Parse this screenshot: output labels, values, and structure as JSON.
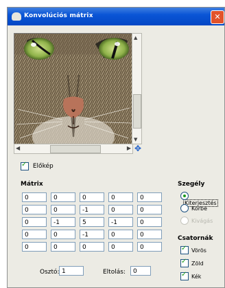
{
  "window": {
    "title": "Konvolúciós mátrix",
    "close_glyph": "✕"
  },
  "preview": {
    "label": "Előkép",
    "checked": true
  },
  "matrix": {
    "title": "Mátrix",
    "rows": [
      [
        "0",
        "0",
        "0",
        "0",
        "0"
      ],
      [
        "0",
        "0",
        "-1",
        "0",
        "0"
      ],
      [
        "0",
        "-1",
        "5",
        "-1",
        "0"
      ],
      [
        "0",
        "0",
        "-1",
        "0",
        "0"
      ],
      [
        "0",
        "0",
        "0",
        "0",
        "0"
      ]
    ],
    "divisor_label": "Osztó:",
    "divisor_value": "1",
    "offset_label": "Eltolás:",
    "offset_value": "0"
  },
  "border": {
    "title": "Szegély",
    "options": [
      {
        "label": "Kiterjesztés",
        "checked": true,
        "disabled": false
      },
      {
        "label": "Körbe",
        "checked": false,
        "disabled": false
      },
      {
        "label": "Kivágás",
        "checked": false,
        "disabled": true
      }
    ]
  },
  "channels": {
    "title": "Csatornák",
    "items": [
      {
        "label": "Vörös",
        "checked": true
      },
      {
        "label": "Zöld",
        "checked": true
      },
      {
        "label": "Kék",
        "checked": true
      }
    ]
  },
  "colors": {
    "title_bar": "#0447c4",
    "close": "#e2532b",
    "dialog_bg": "#ecebe4"
  }
}
